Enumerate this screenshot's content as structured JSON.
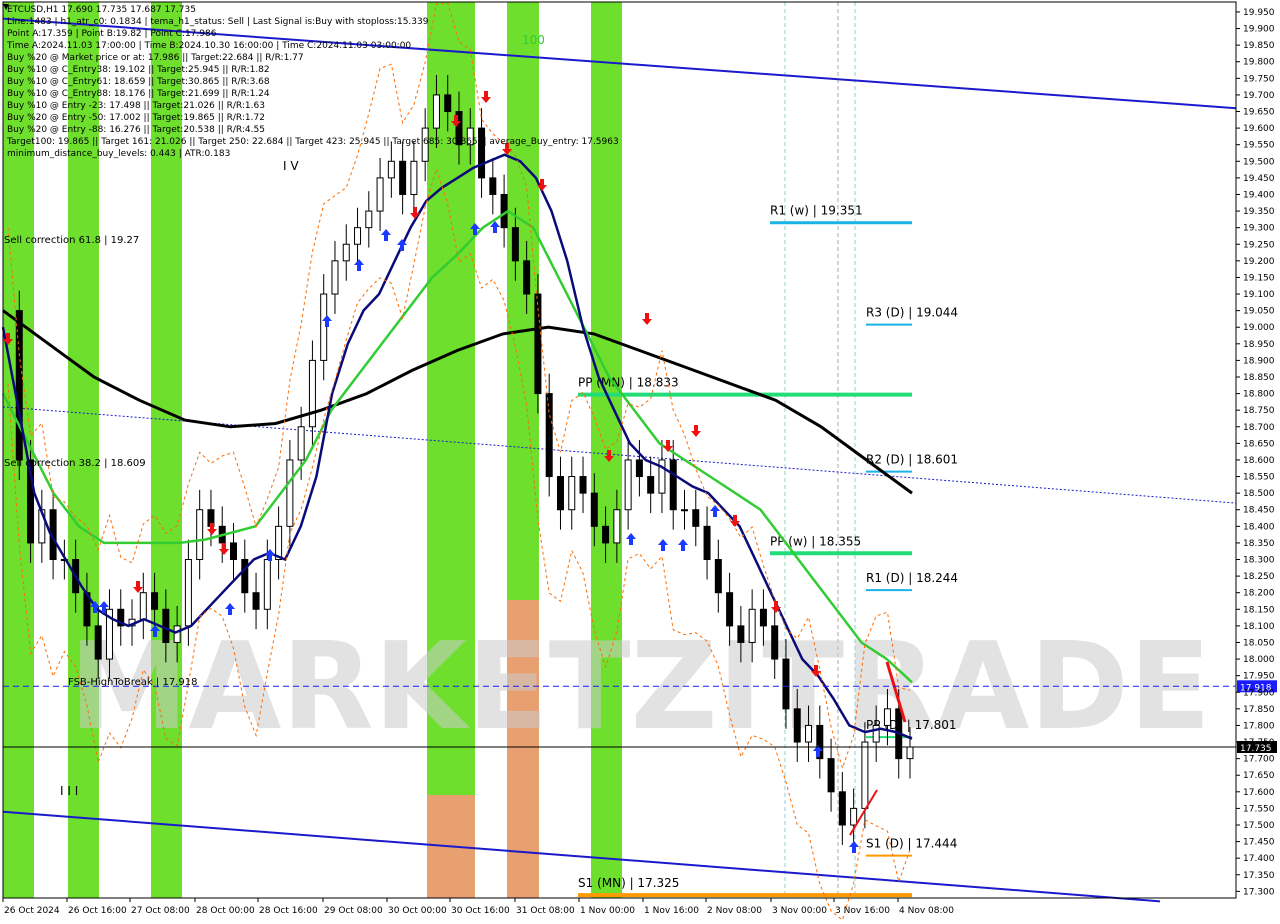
{
  "info_panel": {
    "lines": [
      "ETCUSD,H1  17.690 17.735 17.687 17.735",
      "Line:1483 | h1_atr_c0: 0.1834 | tema_h1_status: Sell | Last Signal is:Buy with stoploss:15.339",
      "Point A:17.359 | Point B:19.82 | Point C:17.986",
      "Time A:2024.11.03 17:00:00 | Time B:2024.10.30 16:00:00 | Time C:2024.11.03 03:00:00",
      "Buy %20 @ Market price or at: 17.986 || Target:22.684 || R/R:1.77",
      "Buy %10 @ C_Entry38: 19.102 || Target:25.945 || R/R:1.82",
      "Buy %10 @ C_Entry61: 18.659 || Target:30.865 || R/R:3.68",
      "Buy %10 @ C_Entry88: 18.176 || Target:21.699 || R/R:1.24",
      "Buy %10 @ Entry -23: 17.498 || Target:21.026 || R/R:1.63",
      "Buy %20 @ Entry -50: 17.002 || Target:19.865 || R/R:1.72",
      "Buy %20 @ Entry -88: 16.276 || Target:20.538 || R/R:4.55",
      "Target100: 19.865 || Target 161: 21.026 || Target 250: 22.684 || Target 423: 25.945 || Target 685: 30.865 || average_Buy_entry: 17.5963",
      "minimum_distance_buy_levels: 0.443 | ATR:0.183"
    ]
  },
  "watermark": "MARKETZITRADE",
  "chart_data": {
    "type": "line",
    "title": "ETCUSD,H1",
    "ohlc_last": {
      "open": 17.69,
      "high": 17.735,
      "low": 17.687,
      "close": 17.735
    },
    "ylim": [
      17.28,
      19.98
    ],
    "y_ticks": [
      "19.950",
      "19.900",
      "19.850",
      "19.800",
      "19.750",
      "19.700",
      "19.650",
      "19.600",
      "19.550",
      "19.500",
      "19.450",
      "19.400",
      "19.350",
      "19.300",
      "19.250",
      "19.200",
      "19.150",
      "19.100",
      "19.050",
      "19.000",
      "18.950",
      "18.900",
      "18.850",
      "18.800",
      "18.750",
      "18.700",
      "18.650",
      "18.600",
      "18.550",
      "18.500",
      "18.450",
      "18.400",
      "18.350",
      "18.300",
      "18.250",
      "18.200",
      "18.150",
      "18.100",
      "18.050",
      "18.000",
      "17.950",
      "17.900",
      "17.850",
      "17.800",
      "17.750",
      "17.700",
      "17.650",
      "17.600",
      "17.550",
      "17.500",
      "17.450",
      "17.400",
      "17.350",
      "17.300"
    ],
    "x_ticks": [
      "26 Oct 2024",
      "26 Oct 16:00",
      "27 Oct 08:00",
      "28 Oct 00:00",
      "28 Oct 16:00",
      "29 Oct 08:00",
      "30 Oct 00:00",
      "30 Oct 16:00",
      "31 Oct 08:00",
      "1 Nov 00:00",
      "1 Nov 16:00",
      "2 Nov 08:00",
      "3 Nov 00:00",
      "3 Nov 16:00",
      "4 Nov 08:00"
    ],
    "price_tags": [
      {
        "label": "17.918",
        "value": 17.918,
        "color": "#1a1aff"
      },
      {
        "label": "17.735",
        "value": 17.735,
        "color": "#000000"
      }
    ],
    "levels": [
      {
        "label": "R1 (w) | 19.351",
        "value": 19.351,
        "color": "#1ab3e6"
      },
      {
        "label": "R3 (D) | 19.044",
        "value": 19.044,
        "color": "#1ab3e6"
      },
      {
        "label": "PP (MN) | 18.833",
        "value": 18.833,
        "color": "#22dd77"
      },
      {
        "label": "R2 (D) | 18.601",
        "value": 18.601,
        "color": "#1ab3e6"
      },
      {
        "label": "PP (w) | 18.355",
        "value": 18.355,
        "color": "#22dd77"
      },
      {
        "label": "R1 (D) | 18.244",
        "value": 18.244,
        "color": "#1ab3e6"
      },
      {
        "label": "PP (D) | 17.801",
        "value": 17.801,
        "color": "#22dd77"
      },
      {
        "label": "S1 (D) | 17.444",
        "value": 17.444,
        "color": "#ff9900"
      },
      {
        "label": "S1 (MN) | 17.325",
        "value": 17.325,
        "color": "#ff9900"
      }
    ],
    "annotations": [
      {
        "label": "Sell correction 61.8 | 19.27",
        "value": 19.27
      },
      {
        "label": "Sell correction 38.2 | 18.609",
        "value": 18.609
      },
      {
        "label": "FSB-HighToBreak | 17.918",
        "value": 17.918
      },
      {
        "label": "I V",
        "value": 19.48
      },
      {
        "label": "100",
        "value": 19.9
      },
      {
        "label": "I I I",
        "value": 17.64
      }
    ],
    "series": [
      {
        "name": "close",
        "color": "#000000",
        "values": [
          19.05,
          18.6,
          18.35,
          18.45,
          18.3,
          18.3,
          18.2,
          18.1,
          18.0,
          18.15,
          18.1,
          18.12,
          18.2,
          18.15,
          18.05,
          18.1,
          18.3,
          18.45,
          18.4,
          18.35,
          18.3,
          18.2,
          18.15,
          18.3,
          18.4,
          18.6,
          18.7,
          18.9,
          19.1,
          19.2,
          19.25,
          19.3,
          19.35,
          19.45,
          19.5,
          19.4,
          19.5,
          19.6,
          19.7,
          19.65,
          19.55,
          19.6,
          19.45,
          19.4,
          19.3,
          19.2,
          19.1,
          18.8,
          18.55,
          18.45,
          18.55,
          18.5,
          18.4,
          18.35,
          18.45,
          18.6,
          18.55,
          18.5,
          18.6,
          18.45,
          18.45,
          18.4,
          18.3,
          18.2,
          18.1,
          18.05,
          18.15,
          18.1,
          18.0,
          17.85,
          17.75,
          17.8,
          17.7,
          17.6,
          17.5,
          17.55,
          17.75,
          17.8,
          17.85,
          17.7,
          17.735
        ]
      },
      {
        "name": "fast_ma",
        "color": "#0a0a7a",
        "values": [
          19.0,
          18.75,
          18.5,
          18.38,
          18.3,
          18.22,
          18.15,
          18.12,
          18.1,
          18.12,
          18.1,
          18.08,
          18.1,
          18.15,
          18.2,
          18.25,
          18.3,
          18.32,
          18.3,
          18.4,
          18.55,
          18.8,
          18.95,
          19.05,
          19.1,
          19.2,
          19.3,
          19.38,
          19.42,
          19.45,
          19.48,
          19.5,
          19.52,
          19.5,
          19.45,
          19.35,
          19.2,
          19.0,
          18.85,
          18.75,
          18.65,
          18.6,
          18.58,
          18.55,
          18.52,
          18.5,
          18.45,
          18.4,
          18.3,
          18.2,
          18.1,
          18.0,
          17.95,
          17.88,
          17.8,
          17.78,
          17.79,
          17.78,
          17.76
        ]
      },
      {
        "name": "mid_ma",
        "color": "#33cc33",
        "values": [
          18.8,
          18.65,
          18.5,
          18.4,
          18.35,
          18.35,
          18.35,
          18.35,
          18.36,
          18.38,
          18.4,
          18.5,
          18.6,
          18.75,
          18.85,
          18.95,
          19.05,
          19.15,
          19.22,
          19.3,
          19.35,
          19.3,
          19.15,
          19.0,
          18.85,
          18.75,
          18.65,
          18.6,
          18.55,
          18.5,
          18.45,
          18.35,
          18.25,
          18.15,
          18.05,
          18.0,
          17.93
        ]
      },
      {
        "name": "slow_ma",
        "color": "#000000",
        "values": [
          19.05,
          18.95,
          18.85,
          18.78,
          18.72,
          18.7,
          18.71,
          18.75,
          18.8,
          18.87,
          18.93,
          18.98,
          19.0,
          18.98,
          18.93,
          18.88,
          18.83,
          18.78,
          18.7,
          18.6,
          18.5
        ]
      }
    ],
    "channel": {
      "upper": [
        19.93,
        19.66
      ],
      "lower": [
        17.54,
        17.27
      ]
    },
    "trend_dotted": [
      18.76,
      18.47
    ]
  }
}
